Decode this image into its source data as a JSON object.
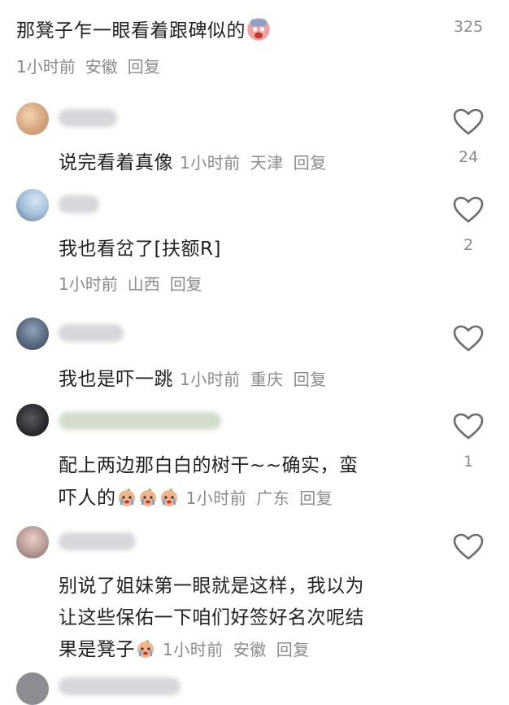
{
  "top_comment": {
    "text": "那凳子乍一眼看着跟碑似的",
    "time": "1小时前",
    "location": "安徽",
    "reply": "回复",
    "likes": "325"
  },
  "comments": [
    {
      "text": "说完看着真像",
      "time": "1小时前",
      "location": "天津",
      "reply": "回复",
      "likes": "24"
    },
    {
      "text": "我也看岔了[扶额R]",
      "time": "1小时前",
      "location": "山西",
      "reply": "回复",
      "likes": "2"
    },
    {
      "text": "我也是吓一跳",
      "time": "1小时前",
      "location": "重庆",
      "reply": "回复",
      "likes": ""
    },
    {
      "text_line1": "配上两边那白白的树干~~确实，蛮",
      "text_line2": "吓人的",
      "time": "1小时前",
      "location": "广东",
      "reply": "回复",
      "likes": "1"
    },
    {
      "text_line1": "别说了姐妹第一眼就是这样，我以为",
      "text_line2": "让这些保佑一下咱们好签好名次呢结",
      "text_line3": "果是凳子",
      "time": "1小时前",
      "location": "安徽",
      "reply": "回复",
      "likes": ""
    }
  ],
  "icons": {
    "like": "heart-outline-icon",
    "emoji": "crying-face-icon"
  },
  "colors": {
    "text": "#1f1f24",
    "meta": "#8a8b91",
    "heart": "#6b6b70"
  }
}
